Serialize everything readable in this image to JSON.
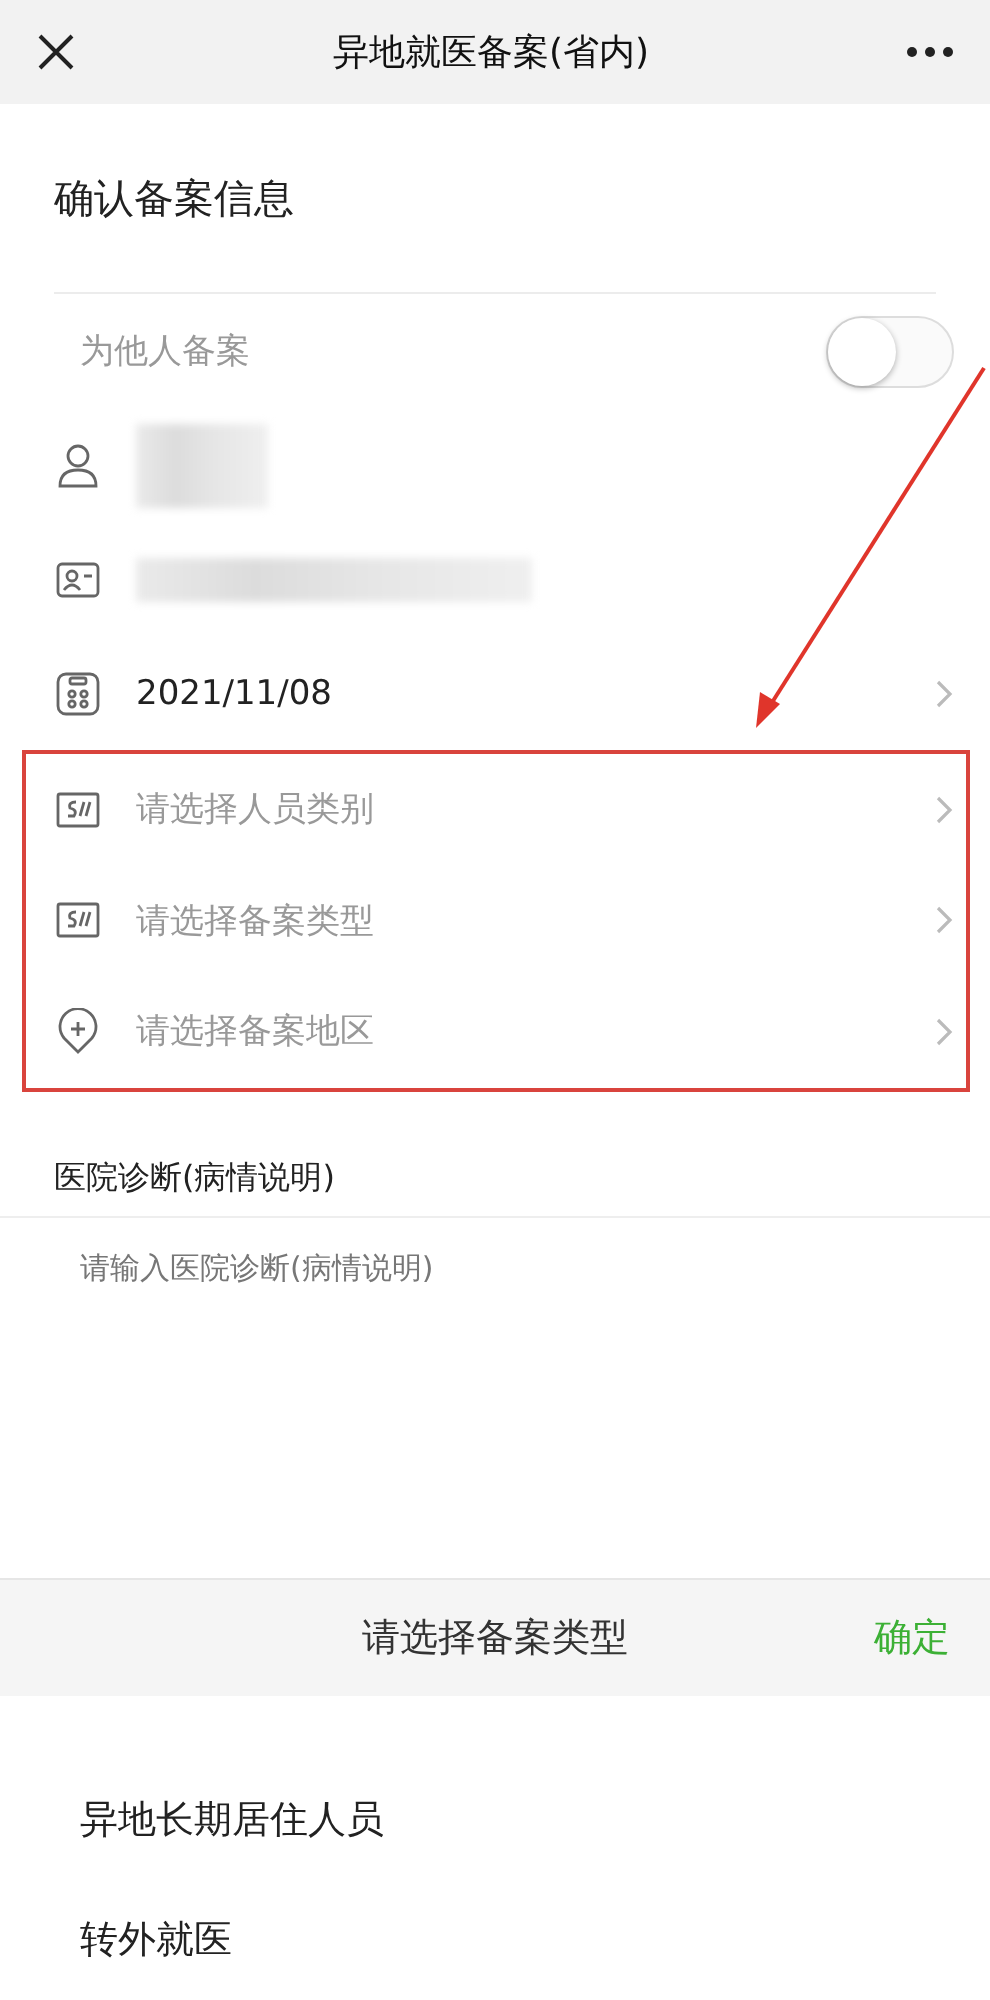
{
  "nav": {
    "title": "异地就医备案(省内)"
  },
  "heading": "确认备案信息",
  "toggle_row": {
    "label": "为他人备案",
    "on": false
  },
  "fields": [
    {
      "kind": "person"
    },
    {
      "kind": "id_card"
    },
    {
      "kind": "date",
      "value": "2021/11/08"
    }
  ],
  "selects": [
    {
      "kind": "badge",
      "placeholder": "请选择人员类别"
    },
    {
      "kind": "badge",
      "placeholder": "请选择备案类型"
    },
    {
      "kind": "location",
      "placeholder": "请选择备案地区"
    }
  ],
  "diagnosis": {
    "label": "医院诊断(病情说明)",
    "placeholder": "请输入医院诊断(病情说明)"
  },
  "picker": {
    "title": "请选择备案类型",
    "confirm": "确定",
    "options": [
      "异地长期居住人员",
      "转外就医"
    ]
  }
}
